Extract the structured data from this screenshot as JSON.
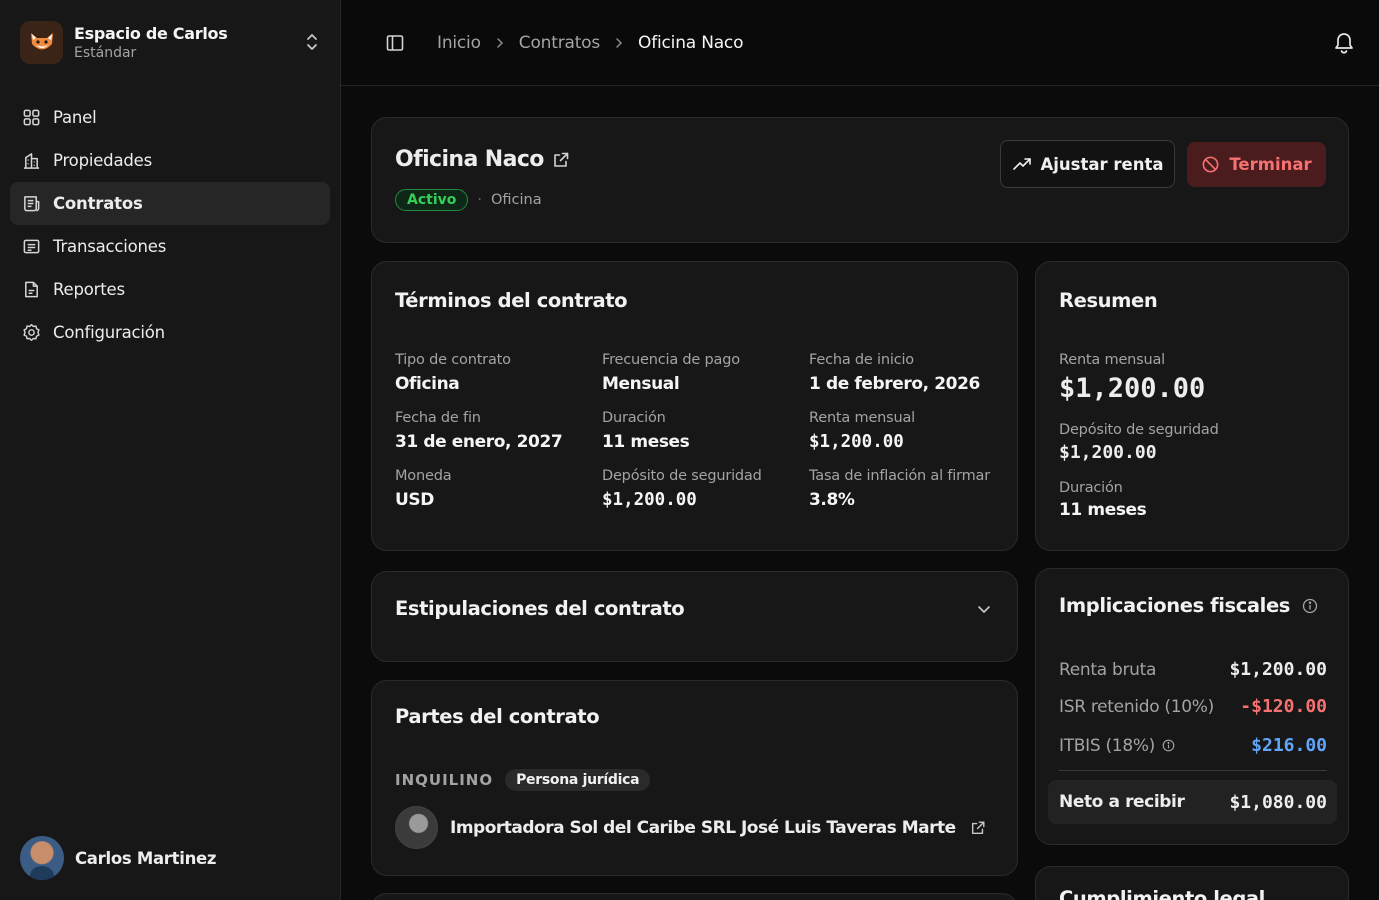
{
  "workspace": {
    "name": "Espacio de Carlos",
    "plan": "Estándar"
  },
  "nav": {
    "items": [
      {
        "label": "Panel",
        "icon": "grid-icon"
      },
      {
        "label": "Propiedades",
        "icon": "building-icon"
      },
      {
        "label": "Contratos",
        "icon": "document-icon",
        "active": true
      },
      {
        "label": "Transacciones",
        "icon": "receipt-icon"
      },
      {
        "label": "Reportes",
        "icon": "file-icon"
      },
      {
        "label": "Configuración",
        "icon": "gear-icon"
      }
    ]
  },
  "user": {
    "name": "Carlos Martinez"
  },
  "breadcrumb": [
    "Inicio",
    "Contratos",
    "Oficina Naco"
  ],
  "contract": {
    "title": "Oficina Naco",
    "status": "Activo",
    "type": "Oficina",
    "adjust_label": "Ajustar renta",
    "terminate_label": "Terminar"
  },
  "terms": {
    "title": "Términos del contrato",
    "fields": [
      {
        "label": "Tipo de contrato",
        "value": "Oficina",
        "mono": false
      },
      {
        "label": "Frecuencia de pago",
        "value": "Mensual",
        "mono": false
      },
      {
        "label": "Fecha de inicio",
        "value": "1 de febrero, 2026",
        "mono": false
      },
      {
        "label": "Fecha de fin",
        "value": "31 de enero, 2027",
        "mono": false
      },
      {
        "label": "Duración",
        "value": "11 meses",
        "mono": false
      },
      {
        "label": "Renta mensual",
        "value": "$1,200.00",
        "mono": true
      },
      {
        "label": "Moneda",
        "value": "USD",
        "mono": false
      },
      {
        "label": "Depósito de seguridad",
        "value": "$1,200.00",
        "mono": true
      },
      {
        "label": "Tasa de inflación al firmar",
        "value": "3.8%",
        "mono": false
      }
    ]
  },
  "summary": {
    "title": "Resumen",
    "rent_label": "Renta mensual",
    "rent_value": "$1,200.00",
    "deposit_label": "Depósito de seguridad",
    "deposit_value": "$1,200.00",
    "duration_label": "Duración",
    "duration_value": "11 meses"
  },
  "stipulations": {
    "title": "Estipulaciones del contrato"
  },
  "parties": {
    "title": "Partes del contrato",
    "role": "INQUILINO",
    "entity_type": "Persona jurídica",
    "name": "Importadora Sol del Caribe SRL José Luis Taveras Marte"
  },
  "fiscal": {
    "title": "Implicaciones fiscales",
    "gross_label": "Renta bruta",
    "gross_value": "$1,200.00",
    "isr_label": "ISR retenido (10%)",
    "isr_value": "-$120.00",
    "itbis_label": "ITBIS (18%)",
    "itbis_value": "$216.00",
    "net_label": "Neto a recibir",
    "net_value": "$1,080.00",
    "colors": {
      "negative": "#f87171",
      "tax": "#60a5fa"
    }
  },
  "legal": {
    "title": "Cumplimiento legal"
  }
}
